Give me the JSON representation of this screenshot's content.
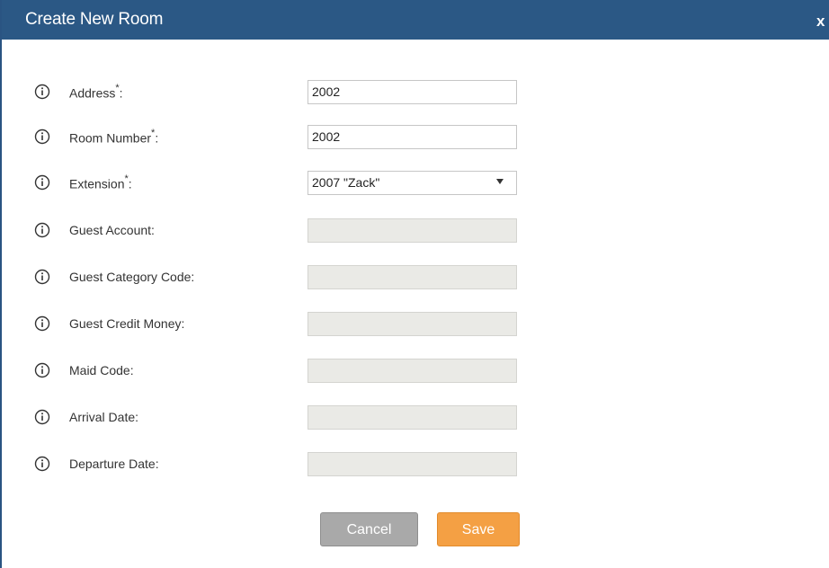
{
  "dialog": {
    "title": "Create New Room",
    "close_label": "x"
  },
  "fields": [
    {
      "label": "Address",
      "required": true,
      "value": "2002",
      "type": "text"
    },
    {
      "label": "Room Number",
      "required": true,
      "value": "2002",
      "type": "text"
    },
    {
      "label": "Extension",
      "required": true,
      "value": "2007 \"Zack\"",
      "type": "select"
    },
    {
      "label": "Guest Account:",
      "required": false,
      "value": "",
      "type": "disabled"
    },
    {
      "label": "Guest Category Code:",
      "required": false,
      "value": "",
      "type": "disabled"
    },
    {
      "label": "Guest Credit Money:",
      "required": false,
      "value": "",
      "type": "disabled"
    },
    {
      "label": "Maid Code:",
      "required": false,
      "value": "",
      "type": "disabled"
    },
    {
      "label": "Arrival Date:",
      "required": false,
      "value": "",
      "type": "disabled"
    },
    {
      "label": "Departure Date:",
      "required": false,
      "value": "",
      "type": "disabled"
    }
  ],
  "required_marker": "*",
  "required_colon": ":",
  "buttons": {
    "cancel_label": "Cancel",
    "save_label": "Save"
  },
  "colors": {
    "titlebar": "#2b5885",
    "save_button": "#f4a044",
    "cancel_button": "#a9a9a9",
    "disabled_field": "#eaeae6"
  },
  "icons": {
    "row_icon": "info-icon"
  }
}
